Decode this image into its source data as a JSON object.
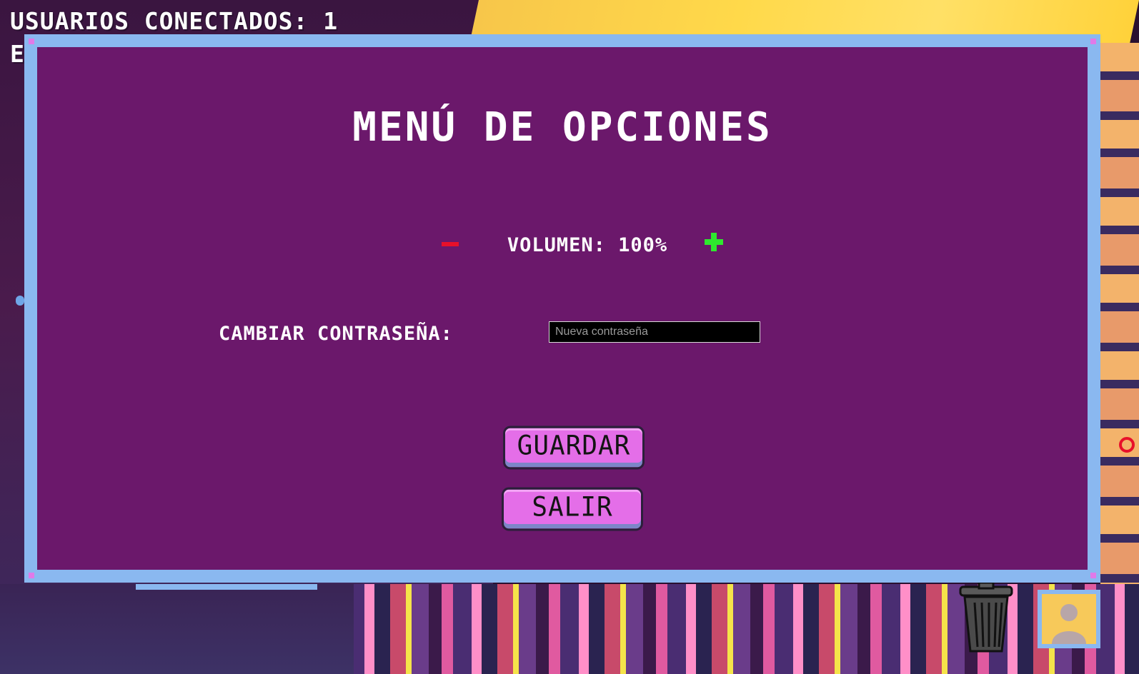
{
  "hud": {
    "users_connected": "USUARIOS CONECTADOS: 1",
    "second_line": "E"
  },
  "options_menu": {
    "title": "MENÚ DE OPCIONES",
    "volume": {
      "minus_icon": "minus-icon",
      "label": "VOLUMEN: 100%",
      "level_percent": 100,
      "plus_icon": "plus-icon"
    },
    "password": {
      "label": "CAMBIAR CONTRASEÑA:",
      "value": "",
      "placeholder": "Nueva contraseña"
    },
    "save_label": "GUARDAR",
    "exit_label": "SALIR"
  },
  "dock": {
    "trash_icon": "trash-icon",
    "profile_icon": "user-silhouette-icon"
  },
  "colors": {
    "modal_frame": "#8ab8f0",
    "modal_background": "#6b186b",
    "button_fill": "#e46ee8",
    "minus_red": "#e8102a",
    "plus_green": "#2ee82e"
  }
}
